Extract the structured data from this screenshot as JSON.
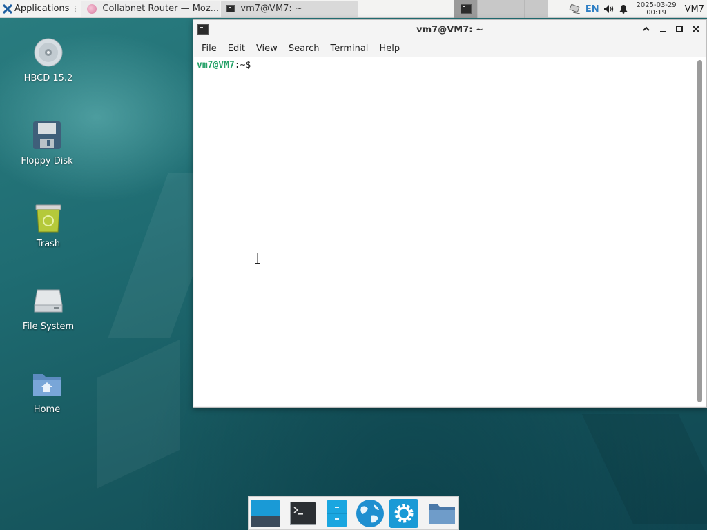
{
  "top_panel": {
    "applications_label": "Applications",
    "tasks": [
      {
        "label": "Collabnet Router — Moz..."
      },
      {
        "label": "vm7@VM7: ~"
      }
    ],
    "keyboard_layout": "EN",
    "clock_date": "2025-03-29",
    "clock_time": "00:19",
    "host": "VM7"
  },
  "desktop": {
    "icons": [
      {
        "label": "HBCD 15.2"
      },
      {
        "label": "Floppy Disk"
      },
      {
        "label": "Trash"
      },
      {
        "label": "File System"
      },
      {
        "label": "Home"
      }
    ]
  },
  "terminal": {
    "title": "vm7@VM7: ~",
    "menu": [
      "File",
      "Edit",
      "View",
      "Search",
      "Terminal",
      "Help"
    ],
    "prompt_user": "vm7@VM7",
    "prompt_sep": ":",
    "prompt_path": "~$"
  },
  "colors": {
    "prompt_green": "#26a269",
    "accent_blue": "#2f7fc4"
  }
}
